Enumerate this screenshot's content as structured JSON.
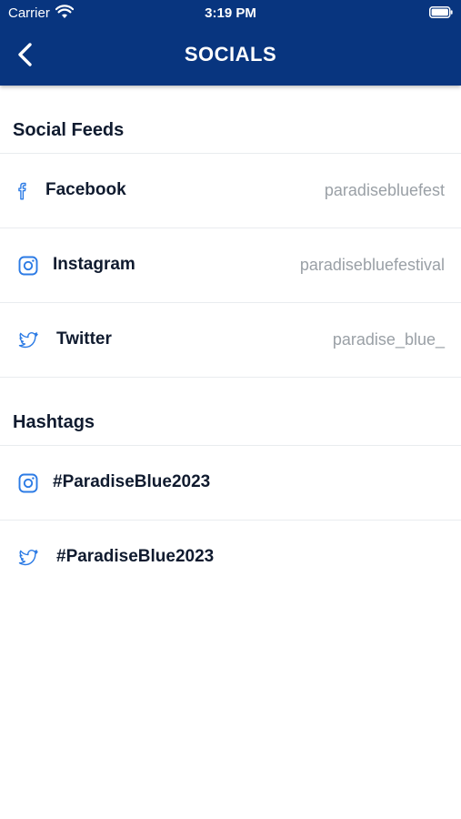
{
  "status_bar": {
    "carrier": "Carrier",
    "time": "3:19 PM",
    "wifi_icon": "wifi-icon",
    "battery_icon": "battery-icon"
  },
  "header": {
    "title": "SOCIALS",
    "back_icon": "chevron-left-icon",
    "background_color": "#08357f"
  },
  "social_feeds": {
    "title": "Social Feeds",
    "items": [
      {
        "label": "Facebook",
        "value": "paradisebluefest",
        "icon": "facebook-icon"
      },
      {
        "label": "Instagram",
        "value": "paradisebluefestival",
        "icon": "instagram-icon"
      },
      {
        "label": "Twitter",
        "value": "paradise_blue_",
        "icon": "twitter-icon"
      }
    ]
  },
  "hashtags": {
    "title": "Hashtags",
    "items": [
      {
        "label": "#ParadiseBlue2023",
        "icon": "instagram-icon"
      },
      {
        "label": "#ParadiseBlue2023",
        "icon": "twitter-icon"
      }
    ]
  },
  "colors": {
    "accent_icon": "#2c7be5",
    "text_primary": "#101b2f",
    "text_secondary": "#9aa0a6"
  }
}
